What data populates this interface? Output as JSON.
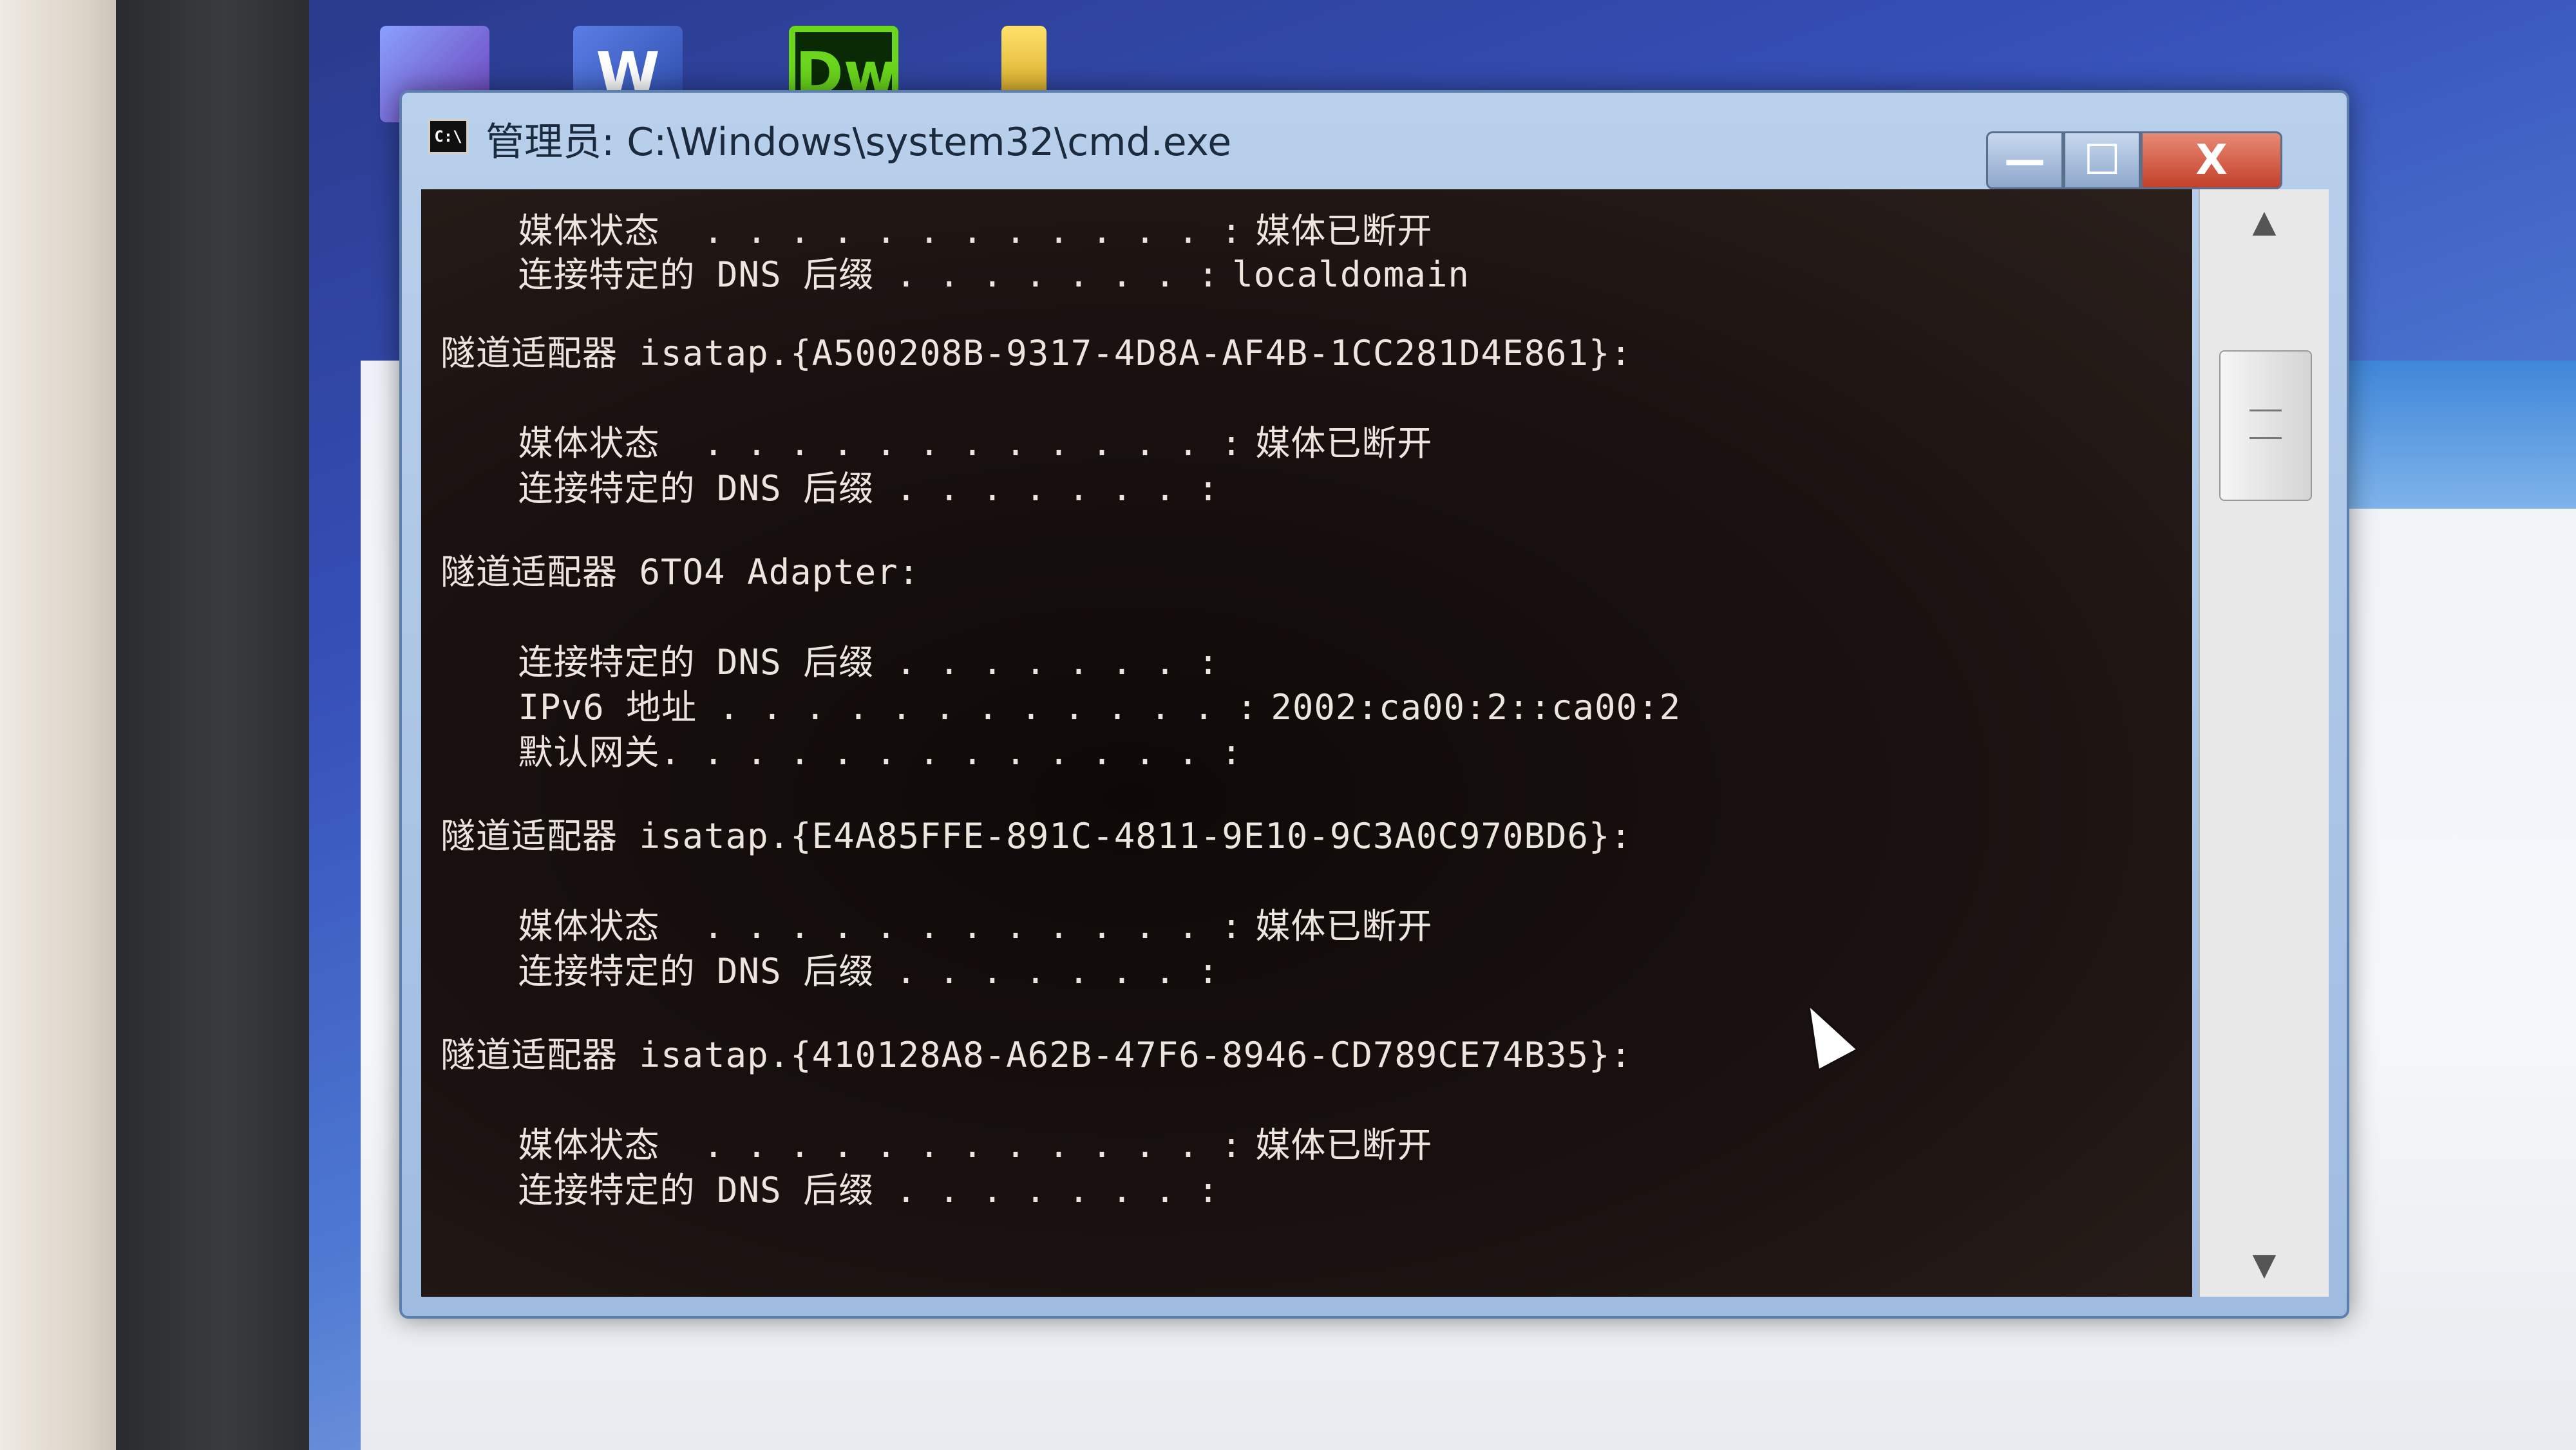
{
  "window": {
    "title": "管理员: C:\\Windows\\system32\\cmd.exe",
    "icon_label": "C:\\",
    "minimize": "—",
    "maximize": "☐",
    "close": "X"
  },
  "desktop": {
    "icons": [
      "word-icon",
      "dreamweaver-icon",
      "file-icon"
    ],
    "icon_glyphs": [
      "W",
      "Dw",
      ""
    ]
  },
  "console": {
    "lines": [
      {
        "text": "   媒体状态  . . . . . . . . . . . . :",
        "value": "媒体已断开"
      },
      {
        "text": "   连接特定的 DNS 后缀 . . . . . . . :",
        "value": "localdomain"
      },
      {
        "text": "隧道适配器 isatap.{A500208B-9317-4D8A-AF4B-1CC281D4E861}:",
        "value": ""
      },
      {
        "text": "   媒体状态  . . . . . . . . . . . . :",
        "value": "媒体已断开"
      },
      {
        "text": "   连接特定的 DNS 后缀 . . . . . . . :",
        "value": ""
      },
      {
        "text": "隧道适配器 6TO4 Adapter:",
        "value": ""
      },
      {
        "text": "   连接特定的 DNS 后缀 . . . . . . . :",
        "value": ""
      },
      {
        "text": "   IPv6 地址 . . . . . . . . . . . . :",
        "value": "2002:ca00:2::ca00:2"
      },
      {
        "text": "   默认网关. . . . . . . . . . . . . :",
        "value": ""
      },
      {
        "text": "隧道适配器 isatap.{E4A85FFE-891C-4811-9E10-9C3A0C970BD6}:",
        "value": ""
      },
      {
        "text": "   媒体状态  . . . . . . . . . . . . :",
        "value": "媒体已断开"
      },
      {
        "text": "   连接特定的 DNS 后缀 . . . . . . . :",
        "value": ""
      },
      {
        "text": "隧道适配器 isatap.{410128A8-A62B-47F6-8946-CD789CE74B35}:",
        "value": ""
      },
      {
        "text": "   媒体状态  . . . . . . . . . . . . :",
        "value": "媒体已断开"
      },
      {
        "text": "   连接特定的 DNS 后缀 . . . . . . . :",
        "value": ""
      }
    ]
  },
  "scrollbar": {
    "up": "▲",
    "down": "▼"
  }
}
